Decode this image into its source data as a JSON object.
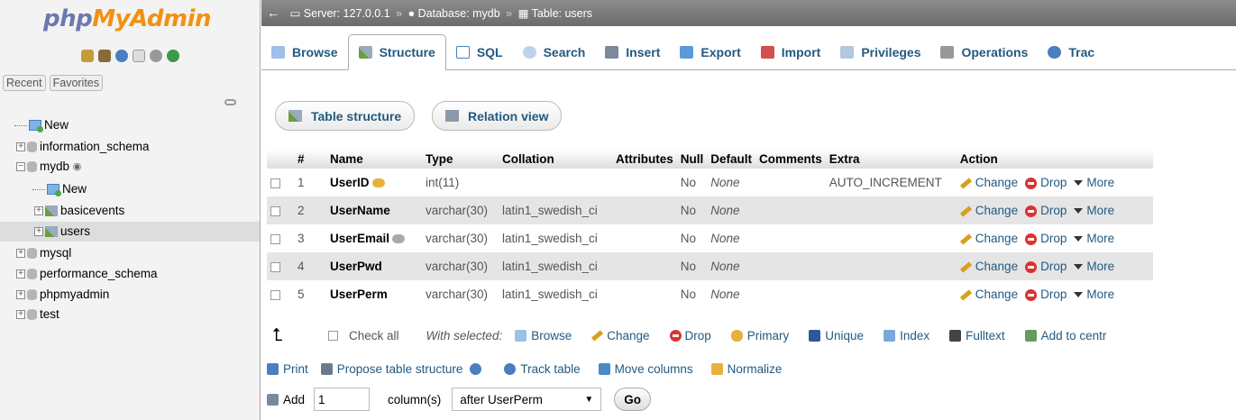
{
  "nav": {
    "logo_part1": "php",
    "logo_part2": "MyAdmin",
    "recent_tab": "Recent",
    "favorites_tab": "Favorites",
    "tree": [
      {
        "label": "New"
      },
      {
        "label": "information_schema"
      },
      {
        "label": "mydb"
      },
      {
        "label": "New"
      },
      {
        "label": "basicevents"
      },
      {
        "label": "users"
      },
      {
        "label": "mysql"
      },
      {
        "label": "performance_schema"
      },
      {
        "label": "phpmyadmin"
      },
      {
        "label": "test"
      }
    ]
  },
  "breadcrumb": {
    "server": "Server: 127.0.0.1",
    "database": "Database: mydb",
    "table": "Table: users"
  },
  "tabs": [
    "Browse",
    "Structure",
    "SQL",
    "Search",
    "Insert",
    "Export",
    "Import",
    "Privileges",
    "Operations",
    "Trac"
  ],
  "subnav": {
    "table_structure": "Table structure",
    "relation_view": "Relation view"
  },
  "table": {
    "headers": [
      "#",
      "Name",
      "Type",
      "Collation",
      "Attributes",
      "Null",
      "Default",
      "Comments",
      "Extra",
      "Action"
    ],
    "rows": [
      {
        "num": "1",
        "name": "UserID",
        "type": "int(11)",
        "collation": "",
        "attributes": "",
        "null": "No",
        "default": "None",
        "comments": "",
        "extra": "AUTO_INCREMENT"
      },
      {
        "num": "2",
        "name": "UserName",
        "type": "varchar(30)",
        "collation": "latin1_swedish_ci",
        "attributes": "",
        "null": "No",
        "default": "None",
        "comments": "",
        "extra": ""
      },
      {
        "num": "3",
        "name": "UserEmail",
        "type": "varchar(30)",
        "collation": "latin1_swedish_ci",
        "attributes": "",
        "null": "No",
        "default": "None",
        "comments": "",
        "extra": ""
      },
      {
        "num": "4",
        "name": "UserPwd",
        "type": "varchar(30)",
        "collation": "latin1_swedish_ci",
        "attributes": "",
        "null": "No",
        "default": "None",
        "comments": "",
        "extra": ""
      },
      {
        "num": "5",
        "name": "UserPerm",
        "type": "varchar(30)",
        "collation": "latin1_swedish_ci",
        "attributes": "",
        "null": "No",
        "default": "None",
        "comments": "",
        "extra": ""
      }
    ],
    "actions": {
      "change": "Change",
      "drop": "Drop",
      "more": "More"
    }
  },
  "bulk": {
    "check_all": "Check all",
    "with_selected": "With selected:",
    "items": [
      "Browse",
      "Change",
      "Drop",
      "Primary",
      "Unique",
      "Index",
      "Fulltext",
      "Add to centr"
    ]
  },
  "bottom_links": [
    "Print",
    "Propose table structure",
    "Track table",
    "Move columns",
    "Normalize"
  ],
  "add_columns": {
    "label": "Add",
    "count": "1",
    "unit": "column(s)",
    "position": "after UserPerm",
    "go": "Go"
  }
}
